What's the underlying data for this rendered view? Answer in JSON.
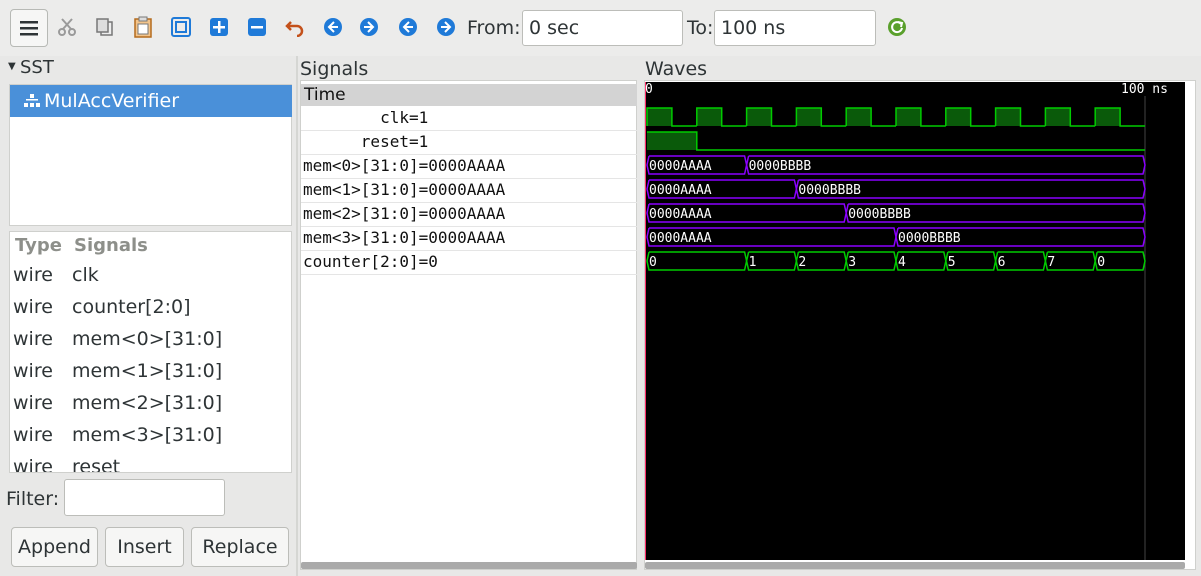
{
  "toolbar": {
    "icons": [
      "menu-icon",
      "cut-icon",
      "copy-icon",
      "paste-icon",
      "zoom-fit-icon",
      "zoom-in-icon",
      "zoom-out-icon",
      "undo-icon",
      "zoom-start-icon",
      "zoom-end-icon",
      "prev-icon",
      "next-icon",
      "reload-icon"
    ],
    "from_label": "From:",
    "from_value": "0 sec",
    "to_label": "To:",
    "to_value": "100 ns"
  },
  "sst": {
    "title": "SST",
    "tree_item": "MulAccVerifier",
    "columns": {
      "type": "Type",
      "signals": "Signals"
    },
    "rows": [
      {
        "type": "wire",
        "name": "clk"
      },
      {
        "type": "wire",
        "name": "counter[2:0]"
      },
      {
        "type": "wire",
        "name": "mem<0>[31:0]"
      },
      {
        "type": "wire",
        "name": "mem<1>[31:0]"
      },
      {
        "type": "wire",
        "name": "mem<2>[31:0]"
      },
      {
        "type": "wire",
        "name": "mem<3>[31:0]"
      },
      {
        "type": "wire",
        "name": "reset"
      }
    ],
    "filter_label": "Filter:",
    "filter_value": "",
    "buttons": {
      "append": "Append",
      "insert": "Insert",
      "replace": "Replace"
    }
  },
  "signals": {
    "title": "Signals",
    "time_label": "Time",
    "rows": [
      "        clk=1",
      "      reset=1",
      "mem<0>[31:0]=0000AAAA",
      "mem<1>[31:0]=0000AAAA",
      "mem<2>[31:0]=0000AAAA",
      "mem<3>[31:0]=0000AAAA",
      "counter[2:0]=0"
    ]
  },
  "waves": {
    "title": "Waves",
    "time_start": "0",
    "time_end": "100 ns",
    "time_range": [
      0,
      100
    ],
    "clk": {
      "period": 10,
      "high_first": true,
      "initial": 1
    },
    "reset": {
      "high_until": 10
    },
    "mem": [
      {
        "values": [
          "0000AAAA",
          "0000BBBB"
        ],
        "change_at": 20
      },
      {
        "values": [
          "0000AAAA",
          "0000BBBB"
        ],
        "change_at": 30
      },
      {
        "values": [
          "0000AAAA",
          "0000BBBB"
        ],
        "change_at": 40
      },
      {
        "values": [
          "0000AAAA",
          "0000BBBB"
        ],
        "change_at": 50
      }
    ],
    "counter": [
      {
        "t": 0,
        "v": "0"
      },
      {
        "t": 20,
        "v": "1"
      },
      {
        "t": 30,
        "v": "2"
      },
      {
        "t": 40,
        "v": "3"
      },
      {
        "t": 50,
        "v": "4"
      },
      {
        "t": 60,
        "v": "5"
      },
      {
        "t": 70,
        "v": "6"
      },
      {
        "t": 80,
        "v": "7"
      },
      {
        "t": 90,
        "v": "0"
      }
    ],
    "colors": {
      "bit": "#00cc00",
      "bus": "#8a00ff",
      "background": "#000000",
      "cursor": "#ff2d6a"
    }
  }
}
